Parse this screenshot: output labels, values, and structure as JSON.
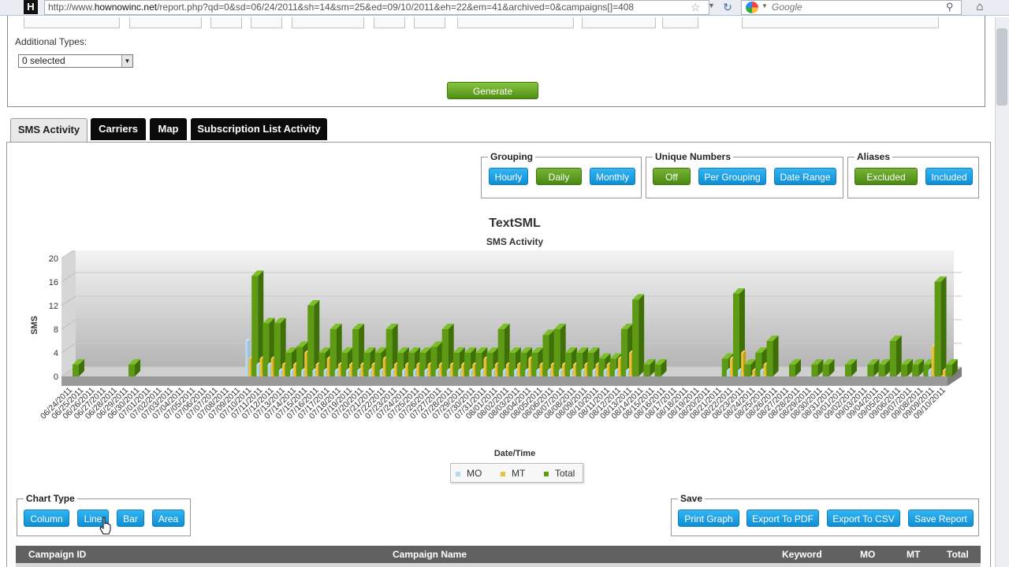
{
  "browser": {
    "url_prefix": "http://www.",
    "url_domain": "hownowinc.net",
    "url_rest": "/report.php?qd=0&sd=06/24/2011&sh=14&sm=25&ed=09/10/2011&eh=22&em=41&archived=0&campaigns[]=408",
    "search_placeholder": "Google",
    "favicon_letter": "H"
  },
  "filters": {
    "additional_types_label": "Additional Types:",
    "additional_types_value": "0 selected",
    "generate_label": "Generate"
  },
  "tabs": [
    {
      "label": "SMS Activity",
      "active": true
    },
    {
      "label": "Carriers",
      "active": false
    },
    {
      "label": "Map",
      "active": false
    },
    {
      "label": "Subscription List Activity",
      "active": false
    }
  ],
  "grouping": {
    "title": "Grouping",
    "hourly": "Hourly",
    "daily": "Daily",
    "monthly": "Monthly",
    "selected": "Daily"
  },
  "unique_numbers": {
    "title": "Unique Numbers",
    "off": "Off",
    "per_grouping": "Per Grouping",
    "date_range": "Date Range",
    "selected": "Off"
  },
  "aliases": {
    "title": "Aliases",
    "excluded": "Excluded",
    "included": "Included",
    "selected": "Excluded"
  },
  "chart_type": {
    "title": "Chart Type",
    "column": "Column",
    "line": "Line",
    "bar": "Bar",
    "area": "Area"
  },
  "save": {
    "title": "Save",
    "print": "Print Graph",
    "pdf": "Export To PDF",
    "csv": "Export To CSV",
    "report": "Save Report"
  },
  "table": {
    "columns": [
      "Campaign ID",
      "Campaign Name",
      "Keyword",
      "MO",
      "MT",
      "Total"
    ]
  },
  "colors": {
    "mo": "#b8d8f0",
    "mt": "#e8c23a",
    "total": "#5e9a14",
    "button_blue": "#1ba3e8",
    "button_green": "#5a9a1c"
  },
  "chart_data": {
    "type": "bar",
    "title": "TextSML",
    "subtitle": "SMS Activity",
    "xlabel": "Date/Time",
    "ylabel": "SMS",
    "ylim": [
      0,
      20
    ],
    "yticks": [
      0,
      4,
      8,
      12,
      16,
      20
    ],
    "legend": [
      "MO",
      "MT",
      "Total"
    ],
    "categories": [
      "06/24/2011",
      "06/25/2011",
      "06/26/2011",
      "06/27/2011",
      "06/28/2011",
      "06/29/2011",
      "06/30/2011",
      "07/01/2011",
      "07/02/2011",
      "07/03/2011",
      "07/04/2011",
      "07/05/2011",
      "07/06/2011",
      "07/07/2011",
      "07/08/2011",
      "07/09/2011",
      "07/10/2011",
      "07/11/2011",
      "07/12/2011",
      "07/13/2011",
      "07/14/2011",
      "07/15/2011",
      "07/16/2011",
      "07/17/2011",
      "07/18/2011",
      "07/19/2011",
      "07/20/2011",
      "07/21/2011",
      "07/22/2011",
      "07/23/2011",
      "07/24/2011",
      "07/25/2011",
      "07/26/2011",
      "07/27/2011",
      "07/28/2011",
      "07/29/2011",
      "07/30/2011",
      "07/31/2011",
      "08/01/2011",
      "08/02/2011",
      "08/03/2011",
      "08/04/2011",
      "08/05/2011",
      "08/06/2011",
      "08/07/2011",
      "08/08/2011",
      "08/09/2011",
      "08/10/2011",
      "08/11/2011",
      "08/12/2011",
      "08/13/2011",
      "08/14/2011",
      "08/15/2011",
      "08/16/2011",
      "08/17/2011",
      "08/18/2011",
      "08/19/2011",
      "08/20/2011",
      "08/21/2011",
      "08/22/2011",
      "08/23/2011",
      "08/24/2011",
      "08/25/2011",
      "08/26/2011",
      "08/27/2011",
      "08/28/2011",
      "08/29/2011",
      "08/30/2011",
      "08/31/2011",
      "09/01/2011",
      "09/02/2011",
      "09/03/2011",
      "09/04/2011",
      "09/05/2011",
      "09/06/2011",
      "09/07/2011",
      "09/08/2011",
      "09/09/2011",
      "09/10/2011"
    ],
    "series": [
      {
        "name": "MO",
        "values": [
          0,
          0,
          0,
          0,
          0,
          0,
          0,
          0,
          0,
          0,
          0,
          0,
          0,
          0,
          0,
          0,
          6,
          2,
          2,
          1,
          1,
          1,
          1,
          1,
          1,
          1,
          1,
          1,
          1,
          1,
          1,
          1,
          1,
          1,
          1,
          1,
          1,
          1,
          1,
          1,
          1,
          1,
          1,
          1,
          1,
          1,
          1,
          1,
          1,
          1,
          1,
          0,
          0,
          0,
          0,
          0,
          0,
          0,
          0,
          1,
          1,
          0,
          1,
          0,
          0,
          0,
          0,
          0,
          0,
          0,
          0,
          0,
          0,
          0,
          0,
          0,
          0,
          1,
          0
        ]
      },
      {
        "name": "MT",
        "values": [
          0,
          0,
          0,
          0,
          0,
          0,
          0,
          0,
          0,
          0,
          0,
          0,
          0,
          0,
          0,
          0,
          3,
          3,
          3,
          2,
          2,
          4,
          2,
          3,
          2,
          2,
          2,
          2,
          3,
          2,
          2,
          2,
          2,
          2,
          2,
          2,
          2,
          3,
          2,
          2,
          2,
          3,
          2,
          2,
          2,
          2,
          2,
          2,
          2,
          3,
          4,
          0,
          0,
          0,
          0,
          0,
          0,
          0,
          0,
          3,
          4,
          1,
          2,
          0,
          0,
          0,
          0,
          0,
          0,
          0,
          0,
          0,
          0,
          0,
          0,
          0,
          0,
          5,
          1
        ]
      },
      {
        "name": "Total",
        "values": [
          2,
          0,
          0,
          0,
          0,
          2,
          0,
          0,
          0,
          0,
          0,
          0,
          0,
          0,
          0,
          0,
          17,
          9,
          9,
          4,
          5,
          12,
          4,
          8,
          4,
          8,
          4,
          4,
          8,
          4,
          4,
          4,
          5,
          8,
          4,
          4,
          4,
          4,
          8,
          4,
          4,
          4,
          7,
          8,
          4,
          4,
          4,
          3,
          3,
          8,
          13,
          2,
          2,
          0,
          0,
          0,
          0,
          0,
          3,
          14,
          2,
          4,
          6,
          0,
          2,
          0,
          2,
          2,
          0,
          2,
          0,
          2,
          2,
          6,
          2,
          2,
          2,
          16,
          2
        ]
      }
    ]
  }
}
